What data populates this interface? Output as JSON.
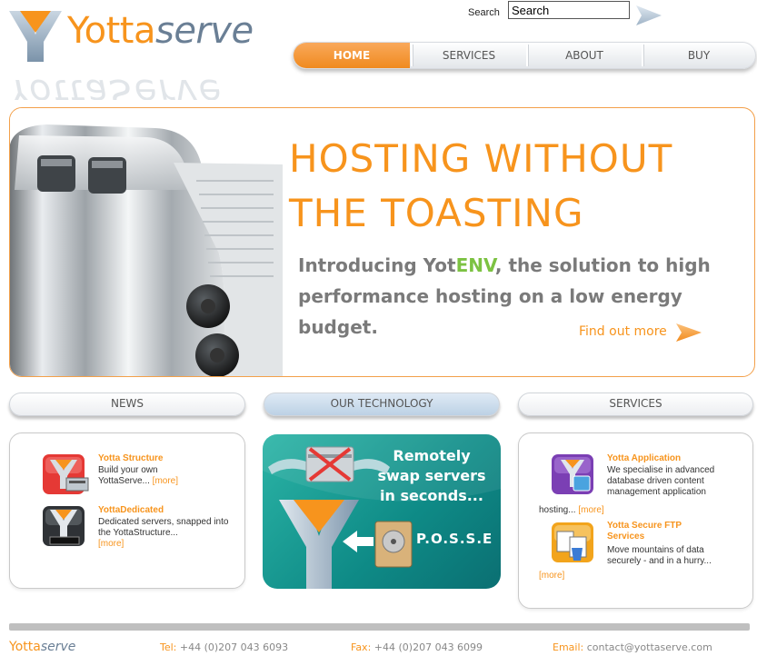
{
  "brand": {
    "name_part1": "Yotta",
    "name_part2": "serve",
    "reflection_text": "YottaServe"
  },
  "search": {
    "label": "Search",
    "value": "Search"
  },
  "nav": {
    "items": [
      {
        "label": "HOME",
        "active": true
      },
      {
        "label": "SERVICES",
        "active": false
      },
      {
        "label": "ABOUT",
        "active": false
      },
      {
        "label": "BUY",
        "active": false
      }
    ]
  },
  "hero": {
    "title_line1": "HOSTING WITHOUT",
    "title_line2": "THE TOASTING",
    "sub_prefix": "Introducing Yot",
    "sub_highlight": "ENV",
    "sub_suffix": ", the solution to high performance hosting on a low energy budget.",
    "cta": "Find out more"
  },
  "sections": {
    "news": {
      "header": "NEWS",
      "items": [
        {
          "title": "Yotta Structure",
          "text": "Build your own YottaServe...",
          "more": "[more]",
          "icon": "structure-icon"
        },
        {
          "title": "YottaDedicated",
          "text": "Dedicated servers, snapped into the YottaStructure...",
          "more": "[more]",
          "icon": "dedicated-icon"
        }
      ]
    },
    "technology": {
      "header": "OUR TECHNOLOGY",
      "headline_line1": "Remotely",
      "headline_line2": "swap servers",
      "headline_line3": "in seconds...",
      "badge": "P.O.S.S.E"
    },
    "services": {
      "header": "SERVICES",
      "items": [
        {
          "title": "Yotta Application",
          "text_line1": "We specialise in advanced database driven content management application",
          "text_line2": "hosting...",
          "more": "[more]",
          "icon": "application-icon"
        },
        {
          "title": "Yotta Secure FTP Services",
          "text": "Move mountains of data securely - and in a hurry...",
          "more": "[more]",
          "icon": "ftp-icon"
        }
      ]
    }
  },
  "footer": {
    "logo_part1": "Yotta",
    "logo_part2": "serve",
    "tel_label": "Tel:",
    "tel_value": "+44 (0)207 043 6093",
    "fax_label": "Fax:",
    "fax_value": "+44 (0)207 043 6099",
    "email_label": "Email:",
    "email_value": "contact@yottaserve.com"
  },
  "colors": {
    "accent": "#f7941d",
    "env_green": "#7cc242",
    "brand_grey": "#6a7f95",
    "tech_teal": "#1a9e94"
  }
}
